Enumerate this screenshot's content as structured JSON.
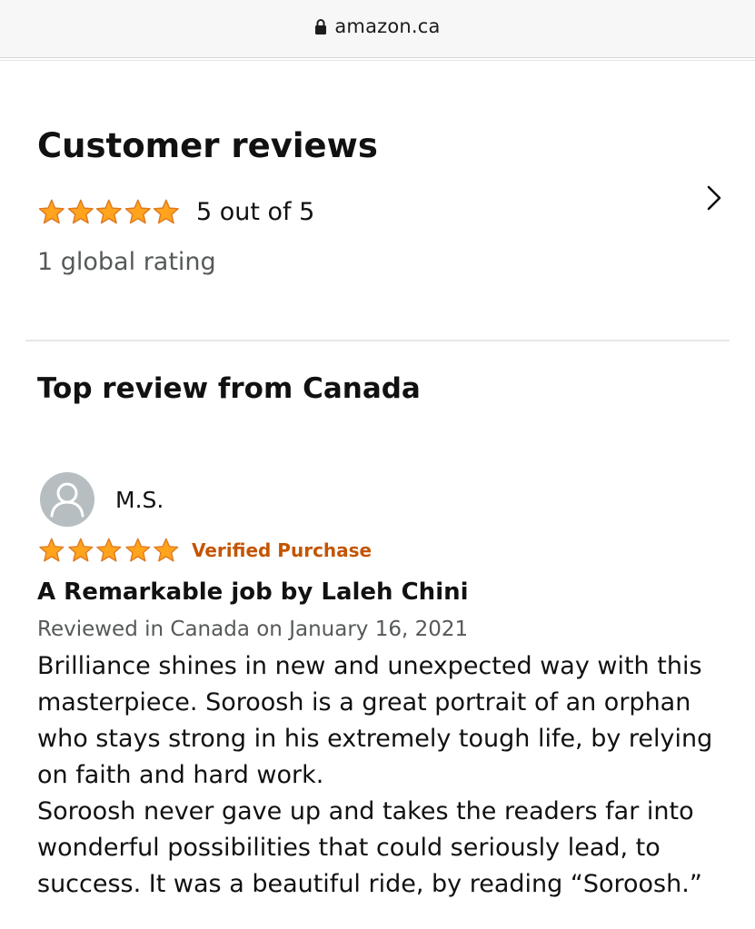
{
  "browser": {
    "url": "amazon.ca",
    "lock_icon": "lock-icon"
  },
  "colors": {
    "star": "#ffa41c",
    "star_outline": "#de7921",
    "verified": "#c45500",
    "muted_text": "#565959",
    "avatar_bg": "#b6bec1"
  },
  "reviews_summary": {
    "title": "Customer reviews",
    "stars": 5,
    "rating_text": "5 out of 5",
    "global_rating": "1 global rating",
    "chevron_icon": "chevron-right-icon"
  },
  "top_review": {
    "section_title": "Top review from Canada",
    "reviewer": "M.S.",
    "avatar_icon": "user-avatar-icon",
    "stars": 5,
    "verified_label": "Verified Purchase",
    "headline": "A Remarkable job by Laleh Chini",
    "date": "Reviewed in Canada on January 16, 2021",
    "body": [
      "Brilliance shines in new and unexpected way with this masterpiece. Soroosh is a great portrait of an orphan who stays strong in his extremely tough life, by relying on faith and hard work.",
      "Soroosh never gave up and takes the readers far into wonderful possibilities that could seriously lead, to success. It was a beautiful ride, by reading “Soroosh.”"
    ]
  }
}
